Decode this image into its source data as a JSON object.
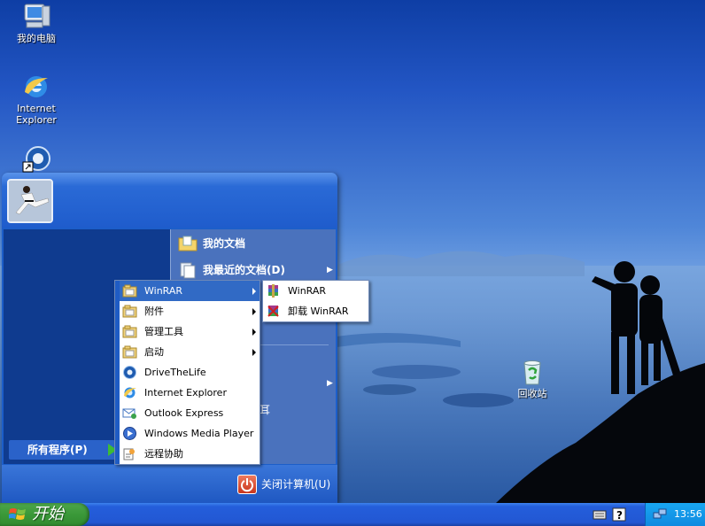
{
  "desktop": {
    "icons": [
      {
        "label": "我的电脑"
      },
      {
        "label": "Internet Explorer"
      },
      {
        "label": "回收站"
      }
    ]
  },
  "start_menu": {
    "all_programs_label": "所有程序(P)",
    "right_items": [
      {
        "label": "我的文档"
      },
      {
        "label": "我最近的文档(D)"
      }
    ],
    "partial_label": "耳",
    "shutdown_label": "关闭计算机(U)"
  },
  "programs_menu": {
    "items": [
      {
        "label": "WinRAR",
        "has_submenu": true,
        "highlighted": true
      },
      {
        "label": "附件",
        "has_submenu": true
      },
      {
        "label": "管理工具",
        "has_submenu": true
      },
      {
        "label": "启动",
        "has_submenu": true
      },
      {
        "label": "DriveTheLife"
      },
      {
        "label": "Internet Explorer"
      },
      {
        "label": "Outlook Express"
      },
      {
        "label": "Windows Media Player"
      },
      {
        "label": "远程协助"
      }
    ]
  },
  "winrar_menu": {
    "items": [
      {
        "label": "WinRAR"
      },
      {
        "label": "卸载 WinRAR"
      }
    ]
  },
  "taskbar": {
    "start_label": "开始",
    "clock": "13:56"
  },
  "colors": {
    "highlight": "#316ac5",
    "start_green": "#3c9a3a",
    "taskbar_blue": "#245edb"
  }
}
